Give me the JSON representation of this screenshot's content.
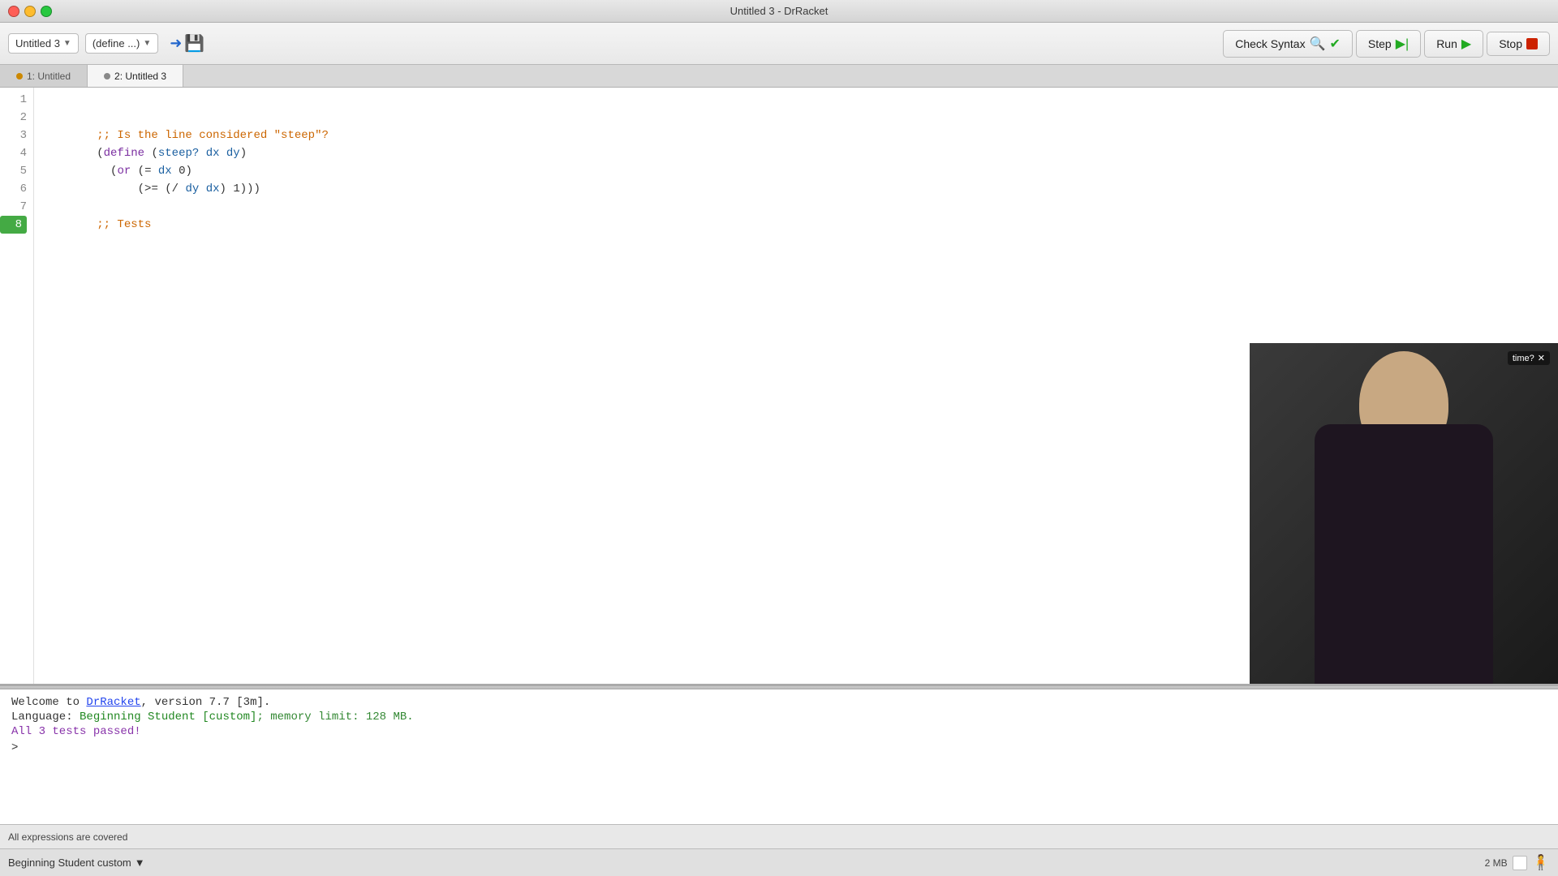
{
  "titleBar": {
    "title": "Untitled 3 - DrRacket"
  },
  "toolbar": {
    "fileDropdown": "Untitled 3",
    "defineDropdown": "(define ...)",
    "checkSyntaxLabel": "Check Syntax",
    "stepLabel": "Step",
    "runLabel": "Run",
    "stopLabel": "Stop"
  },
  "tabs": {
    "tab1Label": "1: Untitled",
    "tab2Label": "2: Untitled 3"
  },
  "editor": {
    "lines": [
      "",
      ";; Is the line considered \"steep\"?",
      "(define (steep? dx dy)",
      "  (or (= dx 0)",
      "      (>= (/ dy dx) 1)))",
      "",
      ";; Tests",
      ""
    ],
    "currentLine": 8
  },
  "repl": {
    "welcomePrefix": "Welcome to ",
    "drracketLink": "DrRacket",
    "welcomeSuffix": ", version 7.7 [3m].",
    "languagePrefix": "Language: ",
    "languageName": "Beginning Student [custom]",
    "memorySuffix": "; memory limit: 128 MB.",
    "testsPassed": "All 3 tests passed!",
    "prompt": ">"
  },
  "statusBar": {
    "coveredText": "All expressions are covered",
    "memoryLabel": "2 MB"
  },
  "bottomToolbar": {
    "languageLabel": "Beginning Student custom"
  },
  "videoOverlay": {
    "timeText": "time?"
  }
}
